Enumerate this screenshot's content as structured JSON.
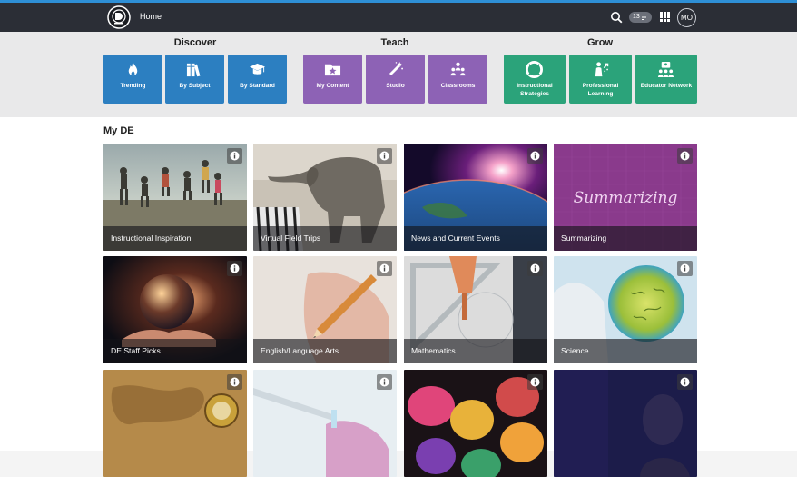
{
  "header": {
    "home_label": "Home",
    "notification_count": "13",
    "avatar_initials": "MO"
  },
  "nav": {
    "groups": [
      {
        "title": "Discover",
        "color": "#2c7fc1",
        "items": [
          {
            "label": "Trending",
            "icon": "flame-icon"
          },
          {
            "label": "By Subject",
            "icon": "books-icon"
          },
          {
            "label": "By Standard",
            "icon": "graduation-cap-icon"
          }
        ]
      },
      {
        "title": "Teach",
        "color": "#8d62b5",
        "items": [
          {
            "label": "My Content",
            "icon": "star-folder-icon"
          },
          {
            "label": "Studio",
            "icon": "magic-wand-icon"
          },
          {
            "label": "Classrooms",
            "icon": "people-group-icon"
          }
        ]
      },
      {
        "title": "Grow",
        "color": "#2ba37a",
        "items": [
          {
            "label_lines": [
              "Instructional",
              "Strategies"
            ],
            "icon": "life-ring-icon"
          },
          {
            "label_lines": [
              "Professional",
              "Learning"
            ],
            "icon": "person-growth-icon"
          },
          {
            "label": "Educator Network",
            "icon": "network-icon"
          }
        ]
      }
    ]
  },
  "section": {
    "title": "My DE"
  },
  "cards": [
    {
      "title": "Instructional Inspiration"
    },
    {
      "title": "Virtual Field Trips"
    },
    {
      "title": "News and Current Events"
    },
    {
      "title": "Summarizing",
      "overlay_text": "Summarizing"
    },
    {
      "title": "DE Staff Picks"
    },
    {
      "title": "English/Language Arts"
    },
    {
      "title": "Mathematics"
    },
    {
      "title": "Science"
    },
    {
      "title": ""
    },
    {
      "title": ""
    },
    {
      "title": ""
    },
    {
      "title": ""
    }
  ]
}
